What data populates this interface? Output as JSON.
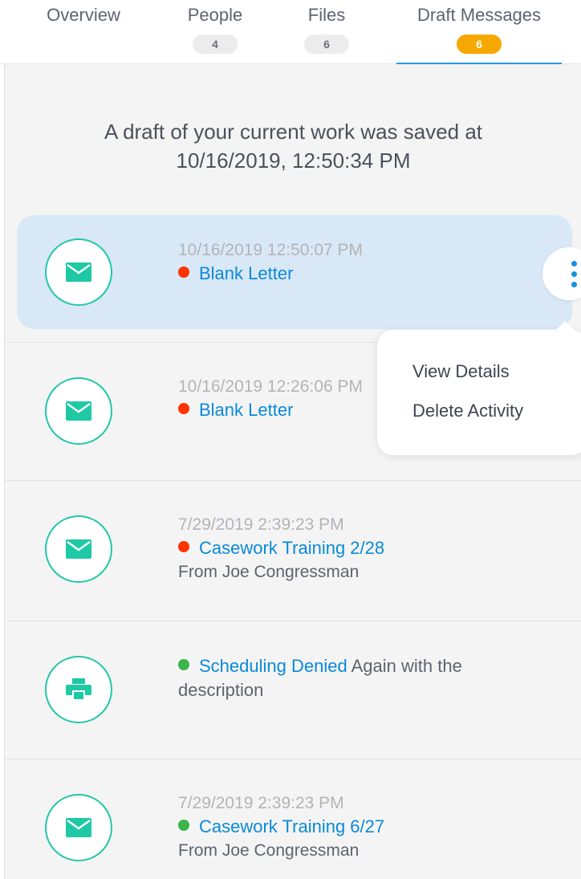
{
  "tabs": [
    {
      "label": "Overview",
      "badge": null,
      "active": false
    },
    {
      "label": "People",
      "badge": "4",
      "active": false
    },
    {
      "label": "Files",
      "badge": "6",
      "active": false
    },
    {
      "label": "Draft Messages",
      "badge": "6",
      "active": true
    }
  ],
  "saved_notice": {
    "line1": "A draft of your current work was saved at",
    "line2": "10/16/2019, 12:50:34 PM"
  },
  "activities": [
    {
      "timestamp": "10/16/2019 12:50:07 PM",
      "status": "red",
      "title": "Blank Letter",
      "icon": "envelope-icon"
    },
    {
      "timestamp": "10/16/2019 12:26:06 PM",
      "status": "red",
      "title": "Blank Letter",
      "icon": "envelope-icon"
    },
    {
      "timestamp": "7/29/2019 2:39:23 PM",
      "status": "red",
      "title": "Casework Training 2/28",
      "from": "From Joe Congressman",
      "icon": "envelope-icon"
    },
    {
      "status": "green",
      "title": "Scheduling Denied",
      "description": "Again with the description",
      "icon": "printer-icon"
    },
    {
      "timestamp": "7/29/2019 2:39:23 PM",
      "status": "green",
      "title": "Casework Training 6/27",
      "from": "From Joe Congressman",
      "icon": "envelope-icon"
    }
  ],
  "context_menu": {
    "items": [
      "View Details",
      "Delete Activity"
    ]
  },
  "colors": {
    "accent": "#1e9bea",
    "badge_active": "#f7a800",
    "icon_ring": "#22c7a7",
    "status_red": "#ff3300",
    "status_green": "#3cb44b",
    "link": "#0a8ad8",
    "selected_row": "#d9e8f6"
  }
}
